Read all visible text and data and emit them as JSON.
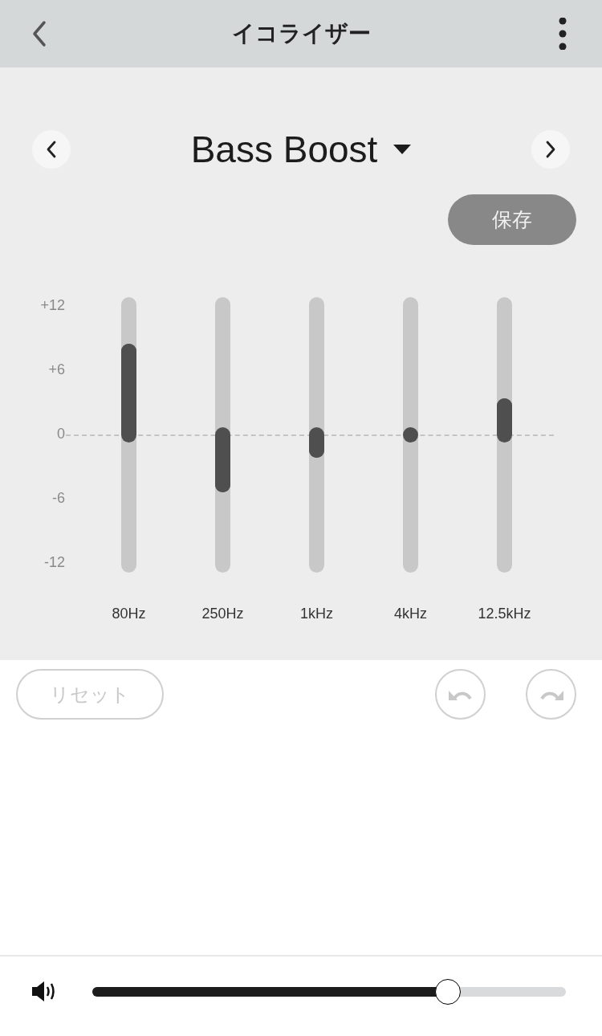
{
  "header": {
    "title": "イコライザー"
  },
  "preset": {
    "name": "Bass Boost"
  },
  "save_button": {
    "label": "保存",
    "disabled": true
  },
  "gain_scale": [
    "+12",
    "+6",
    "0",
    "-6",
    "-12"
  ],
  "bands": [
    {
      "label": "80Hz",
      "level": 0.82
    },
    {
      "label": "250Hz",
      "level": 0.31
    },
    {
      "label": "1kHz",
      "level": 0.44
    },
    {
      "label": "4kHz",
      "level": 0.5
    },
    {
      "label": "12.5kHz",
      "level": 0.61
    }
  ],
  "reset_button": {
    "label": "リセット",
    "disabled": true
  },
  "undo_button": {
    "disabled": true
  },
  "redo_button": {
    "disabled": true
  },
  "volume": {
    "level": 0.75
  }
}
